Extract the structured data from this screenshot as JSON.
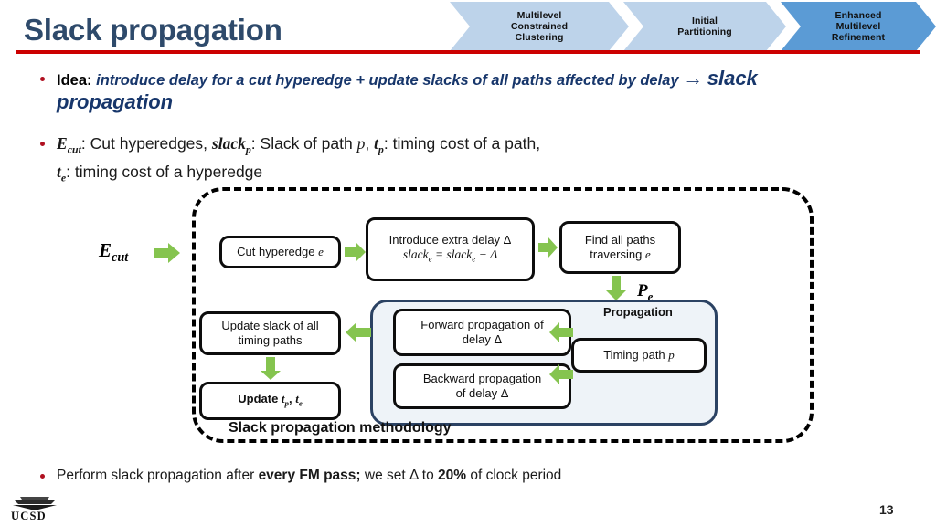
{
  "slide": {
    "title": "Slack propagation",
    "page_number": "13",
    "logo_text": "UCSD",
    "accent_rule_color": "#cc0000",
    "title_color": "#2e4a6b"
  },
  "banner": {
    "steps": [
      {
        "lines": [
          "Multilevel",
          "Constrained",
          "Clustering"
        ],
        "active": false,
        "color": "#bdd3ea"
      },
      {
        "lines": [
          "Initial",
          "Partitioning"
        ],
        "active": false,
        "color": "#bdd3ea"
      },
      {
        "lines": [
          "Enhanced",
          "Multilevel",
          "Refinement"
        ],
        "active": true,
        "color": "#5b9bd5"
      }
    ]
  },
  "bullets": {
    "idea": {
      "lead": "Idea:",
      "emphasis": "introduce delay for a cut hyperedge + update slacks of all paths affected by delay",
      "arrow": "→",
      "highlight": "slack propagation"
    },
    "notation": {
      "e_cut": "E",
      "e_cut_sub": "cut",
      "e_cut_desc": ": Cut hyperedges, ",
      "slack_p": "slack",
      "slack_p_sub": "p",
      "slack_p_desc": ": Slack of path ",
      "p_var": "p",
      "comma1": ", ",
      "t_p": "t",
      "t_p_sub": "p",
      "t_p_desc": ": timing cost of a path,",
      "t_e": "t",
      "t_e_sub": "e",
      "t_e_desc": ": timing cost of a hyperedge"
    },
    "footer_note": {
      "prefix": "Perform slack propagation after ",
      "bold1": "every FM pass;",
      "middle": " we set Δ to ",
      "bold2": "20%",
      "suffix": " of clock period"
    }
  },
  "diagram": {
    "caption": "Slack propagation methodology",
    "input_label": "E",
    "input_label_sub": "cut",
    "paths_label": "P",
    "paths_label_sub": "e",
    "propagation_label": "Propagation",
    "nodes": {
      "cut_hyperedge": {
        "text": "Cut hyperedge ",
        "var": "e"
      },
      "introduce_delay": {
        "line1": "Introduce extra delay Δ",
        "line2": "slack",
        "line2_sub": "e",
        "line2_rest": " = slack",
        "line2_sub2": "e",
        "line2_tail": " − Δ"
      },
      "find_paths": {
        "line1": "Find all paths",
        "line2": "traversing ",
        "var": "e"
      },
      "forward_prop": {
        "line1": "Forward propagation of",
        "line2": "delay Δ"
      },
      "backward_prop": {
        "line1": "Backward propagation",
        "line2": "of delay Δ"
      },
      "timing_path": {
        "text": "Timing path ",
        "var": "p"
      },
      "update_slack": {
        "line1": "Update slack of all",
        "line2": "timing paths"
      },
      "update_t": {
        "prefix": "Update ",
        "var1": "t",
        "sub1": "p",
        "sep": ", ",
        "var2": "t",
        "sub2": "e"
      }
    },
    "arrow_color": "#85c44f",
    "panel_border_color": "#2b4263",
    "panel_fill_color": "#eef3f8"
  }
}
